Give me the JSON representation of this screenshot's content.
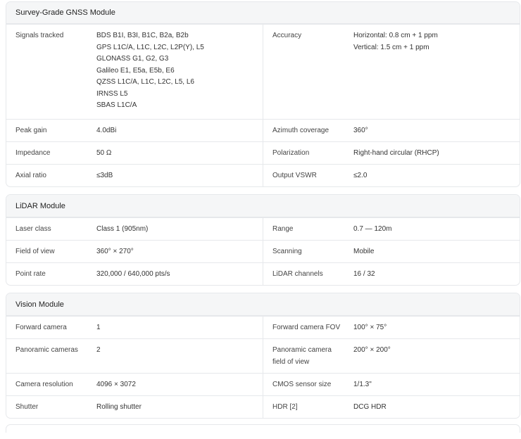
{
  "sections": [
    {
      "title": "Survey-Grade GNSS Module",
      "rows": [
        {
          "l_label": "Signals tracked",
          "l_value": [
            "BDS B1I, B3I, B1C, B2a, B2b",
            "GPS L1C/A, L1C, L2C, L2P(Y), L5",
            "GLONASS G1, G2, G3",
            "Galileo E1, E5a, E5b, E6",
            "QZSS L1C/A, L1C, L2C, L5, L6",
            "IRNSS L5",
            "SBAS L1C/A"
          ],
          "r_label": "Accuracy",
          "r_value": [
            "Horizontal: 0.8 cm + 1 ppm",
            "Vertical: 1.5 cm + 1 ppm"
          ]
        },
        {
          "l_label": "Peak gain",
          "l_value": [
            "4.0dBi"
          ],
          "r_label": "Azimuth coverage",
          "r_value": [
            "360°"
          ]
        },
        {
          "l_label": "Impedance",
          "l_value": [
            "50 Ω"
          ],
          "r_label": "Polarization",
          "r_value": [
            "Right-hand circular (RHCP)"
          ]
        },
        {
          "l_label": "Axial ratio",
          "l_value": [
            "≤3dB"
          ],
          "r_label": "Output VSWR",
          "r_value": [
            "≤2.0"
          ]
        }
      ]
    },
    {
      "title": "LiDAR Module",
      "rows": [
        {
          "l_label": "Laser class",
          "l_value": [
            "Class 1 (905nm)"
          ],
          "r_label": "Range",
          "r_value": [
            "0.7 — 120m"
          ]
        },
        {
          "l_label": "Field of view",
          "l_value": [
            "360° × 270°"
          ],
          "r_label": "Scanning",
          "r_value": [
            "Mobile"
          ]
        },
        {
          "l_label": "Point rate",
          "l_value": [
            "320,000 / 640,000 pts/s"
          ],
          "r_label": "LiDAR channels",
          "r_value": [
            "16 / 32"
          ]
        }
      ]
    },
    {
      "title": "Vision Module",
      "rows": [
        {
          "l_label": "Forward camera",
          "l_value": [
            "1"
          ],
          "r_label": "Forward camera FOV",
          "r_value": [
            "100° × 75°"
          ]
        },
        {
          "l_label": "Panoramic cameras",
          "l_value": [
            "2"
          ],
          "r_label": "Panoramic camera field of view",
          "r_value": [
            "200° × 200°"
          ]
        },
        {
          "l_label": "Camera resolution",
          "l_value": [
            "4096 × 3072"
          ],
          "r_label": "CMOS sensor size",
          "r_value": [
            "1/1.3\""
          ]
        },
        {
          "l_label": "Shutter",
          "l_value": [
            "Rolling shutter"
          ],
          "r_label": "HDR [2]",
          "r_value": [
            "DCG HDR"
          ]
        }
      ]
    }
  ]
}
